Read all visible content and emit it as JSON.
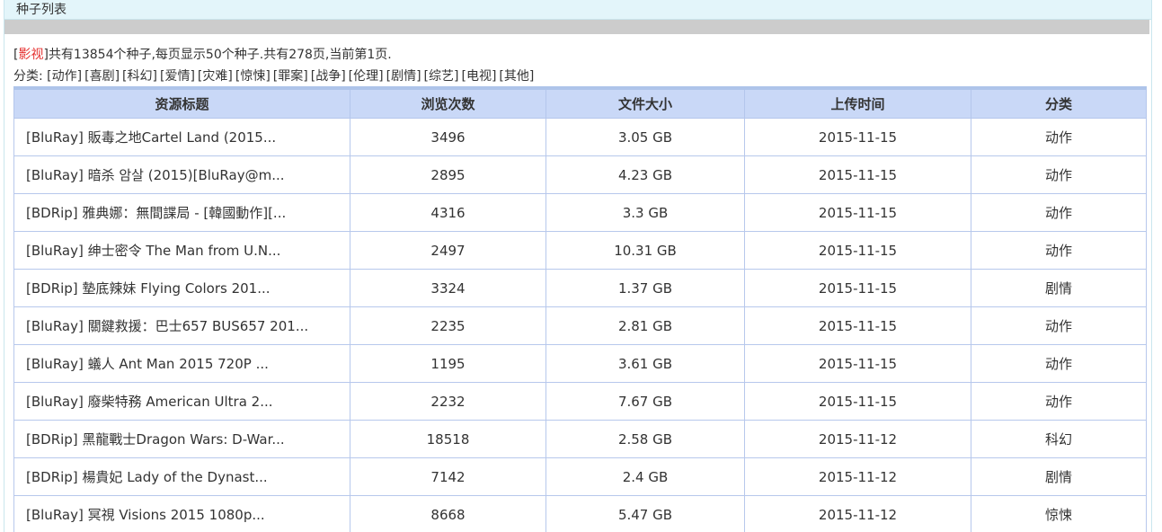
{
  "panel": {
    "title": "种子列表"
  },
  "summary": {
    "open_bracket": "[",
    "category": "影视",
    "close_bracket": "]",
    "text": "共有13854个种子,每页显示50个种子.共有278页,当前第1页."
  },
  "categories": {
    "label": "分类:",
    "items": [
      "[动作]",
      "[喜剧]",
      "[科幻]",
      "[爱情]",
      "[灾难]",
      "[惊悚]",
      "[罪案]",
      "[战争]",
      "[伦理]",
      "[剧情]",
      "[综艺]",
      "[电视]",
      "[其他]"
    ]
  },
  "table": {
    "headers": [
      "资源标题",
      "浏览次数",
      "文件大小",
      "上传时间",
      "分类"
    ],
    "rows": [
      {
        "title": "[BluRay] 販毒之地Cartel Land (2015...",
        "views": "3496",
        "size": "3.05 GB",
        "date": "2015-11-15",
        "category": "动作"
      },
      {
        "title": "[BluRay] 暗杀 암살 (2015)[BluRay@m...",
        "views": "2895",
        "size": "4.23 GB",
        "date": "2015-11-15",
        "category": "动作"
      },
      {
        "title": "[BDRip] 雅典娜：無間諜局 - [韓國動作][...",
        "views": "4316",
        "size": "3.3 GB",
        "date": "2015-11-15",
        "category": "动作"
      },
      {
        "title": "[BluRay] 绅士密令 The Man from U.N...",
        "views": "2497",
        "size": "10.31 GB",
        "date": "2015-11-15",
        "category": "动作"
      },
      {
        "title": "[BDRip] 墊底辣妹 Flying Colors 201...",
        "views": "3324",
        "size": "1.37 GB",
        "date": "2015-11-15",
        "category": "剧情"
      },
      {
        "title": "[BluRay] 關鍵救援：巴士657 BUS657 201...",
        "views": "2235",
        "size": "2.81 GB",
        "date": "2015-11-15",
        "category": "动作"
      },
      {
        "title": "[BluRay] 蟻人 Ant Man 2015 720P ...",
        "views": "1195",
        "size": "3.61 GB",
        "date": "2015-11-15",
        "category": "动作"
      },
      {
        "title": "[BluRay] 廢柴特務 American Ultra 2...",
        "views": "2232",
        "size": "7.67 GB",
        "date": "2015-11-15",
        "category": "动作"
      },
      {
        "title": "[BDRip] 黑龍戰士Dragon Wars: D-War...",
        "views": "18518",
        "size": "2.58 GB",
        "date": "2015-11-12",
        "category": "科幻"
      },
      {
        "title": "[BDRip] 楊貴妃 Lady of the Dynast...",
        "views": "7142",
        "size": "2.4 GB",
        "date": "2015-11-12",
        "category": "剧情"
      },
      {
        "title": "[BluRay] 冥視 Visions 2015 1080p...",
        "views": "8668",
        "size": "5.47 GB",
        "date": "2015-11-12",
        "category": "惊悚"
      }
    ]
  },
  "colors": {
    "header_bg": "#e3f5fa",
    "table_header_bg": "#c9d8f7",
    "border": "#b7c8ec",
    "category_highlight": "#e5302f"
  }
}
